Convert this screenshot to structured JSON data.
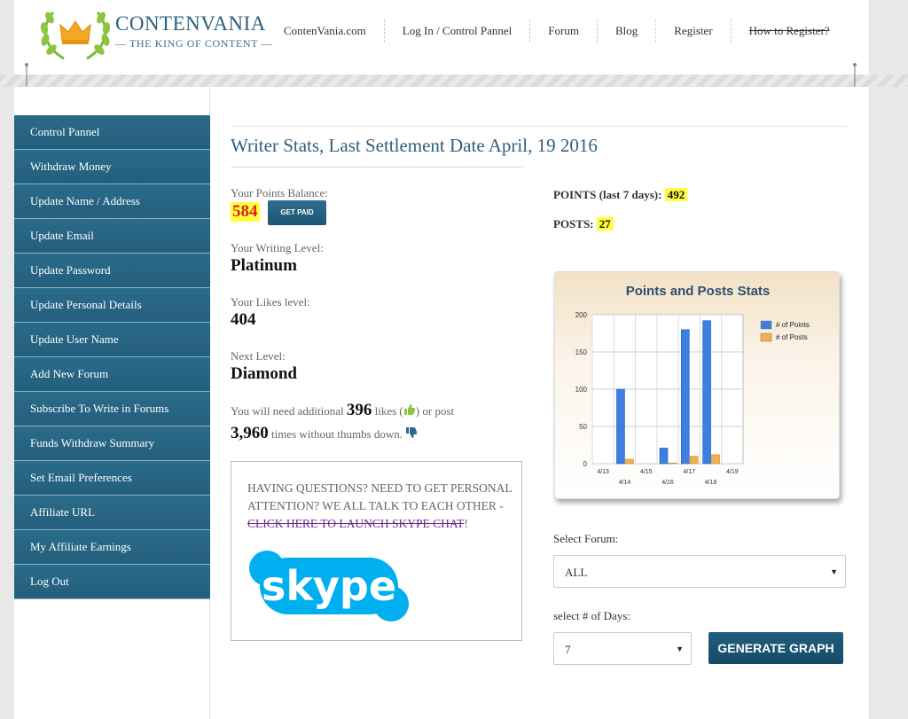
{
  "header": {
    "logo_title": "CONTENVANIA",
    "logo_subtitle": "— THE KING OF CONTENT —",
    "nav": [
      {
        "label": "ContenVania.com"
      },
      {
        "label": "Log In / Control Pannel"
      },
      {
        "label": "Forum"
      },
      {
        "label": "Blog"
      },
      {
        "label": "Register"
      },
      {
        "label": "How to Register?"
      }
    ]
  },
  "sidebar": {
    "items": [
      {
        "label": "Control Pannel"
      },
      {
        "label": "Withdraw Money"
      },
      {
        "label": "Update Name / Address"
      },
      {
        "label": "Update Email"
      },
      {
        "label": "Update Password"
      },
      {
        "label": "Update Personal Details"
      },
      {
        "label": "Update User Name"
      },
      {
        "label": "Add New Forum"
      },
      {
        "label": "Subscribe To Write in Forums"
      },
      {
        "label": "Funds Withdraw Summary"
      },
      {
        "label": "Set Email Preferences"
      },
      {
        "label": "Affiliate URL"
      },
      {
        "label": "My Affiliate Earnings"
      },
      {
        "label": "Log Out"
      }
    ]
  },
  "main": {
    "title": "Writer Stats, Last Settlement Date April, 19 2016",
    "points_balance_label": "Your Points Balance:",
    "points_balance": "584",
    "get_paid_label": "GET PAID",
    "writing_level_label": "Your Writing Level:",
    "writing_level": "Platinum",
    "likes_level_label": "Your Likes level:",
    "likes_level": "404",
    "next_level_label": "Next Level:",
    "next_level": "Diamond",
    "need_prefix": "You will need additional",
    "need_likes": "396",
    "need_mid1": "likes (",
    "need_mid2": ") or post",
    "need_posts": "3,960",
    "need_suffix": "times without thumbs down.",
    "help_text": "HAVING QUESTIONS? NEED TO GET PERSONAL ATTENTION? WE ALL TALK TO EACH OTHER - ",
    "help_link": "CLICK HERE TO LAUNCH SKYPE CHAT",
    "help_end": "!",
    "skype_logo_text": "skype",
    "points_last7_label": "POINTS (last 7 days):",
    "points_last7": "492",
    "posts_label": "POSTS:",
    "posts_value": "27",
    "select_forum_label": "Select Forum:",
    "select_forum_value": "ALL",
    "select_days_label": "select # of Days:",
    "select_days_value": "7",
    "generate_label": "GENERATE GRAPH"
  },
  "colors": {
    "accent": "#2a6b8a",
    "points_series": "#3d7fe0",
    "posts_series": "#f0b050",
    "highlight": "#ffff3b"
  },
  "chart_data": {
    "type": "bar",
    "title": "Points and Posts Stats",
    "categories": [
      "4/13",
      "4/14",
      "4/15",
      "4/16",
      "4/17",
      "4/18",
      "4/19"
    ],
    "series": [
      {
        "name": "# of Points",
        "values": [
          0,
          100,
          0,
          21,
          180,
          192,
          0
        ]
      },
      {
        "name": "# of Posts",
        "values": [
          0,
          6,
          0,
          1,
          10,
          12,
          0
        ]
      }
    ],
    "ylim": [
      0,
      200
    ],
    "yticks": [
      0,
      50,
      100,
      150,
      200
    ],
    "grid": true,
    "legend": "top-right"
  }
}
